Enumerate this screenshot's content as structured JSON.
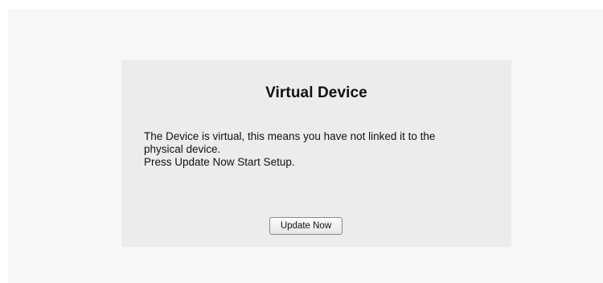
{
  "dialog": {
    "title": "Virtual Device",
    "message_lines": [
      "The Device is virtual, this means you have not linked it to the",
      "physical device.",
      "Press Update Now Start Setup."
    ],
    "button_label": "Update Now"
  }
}
